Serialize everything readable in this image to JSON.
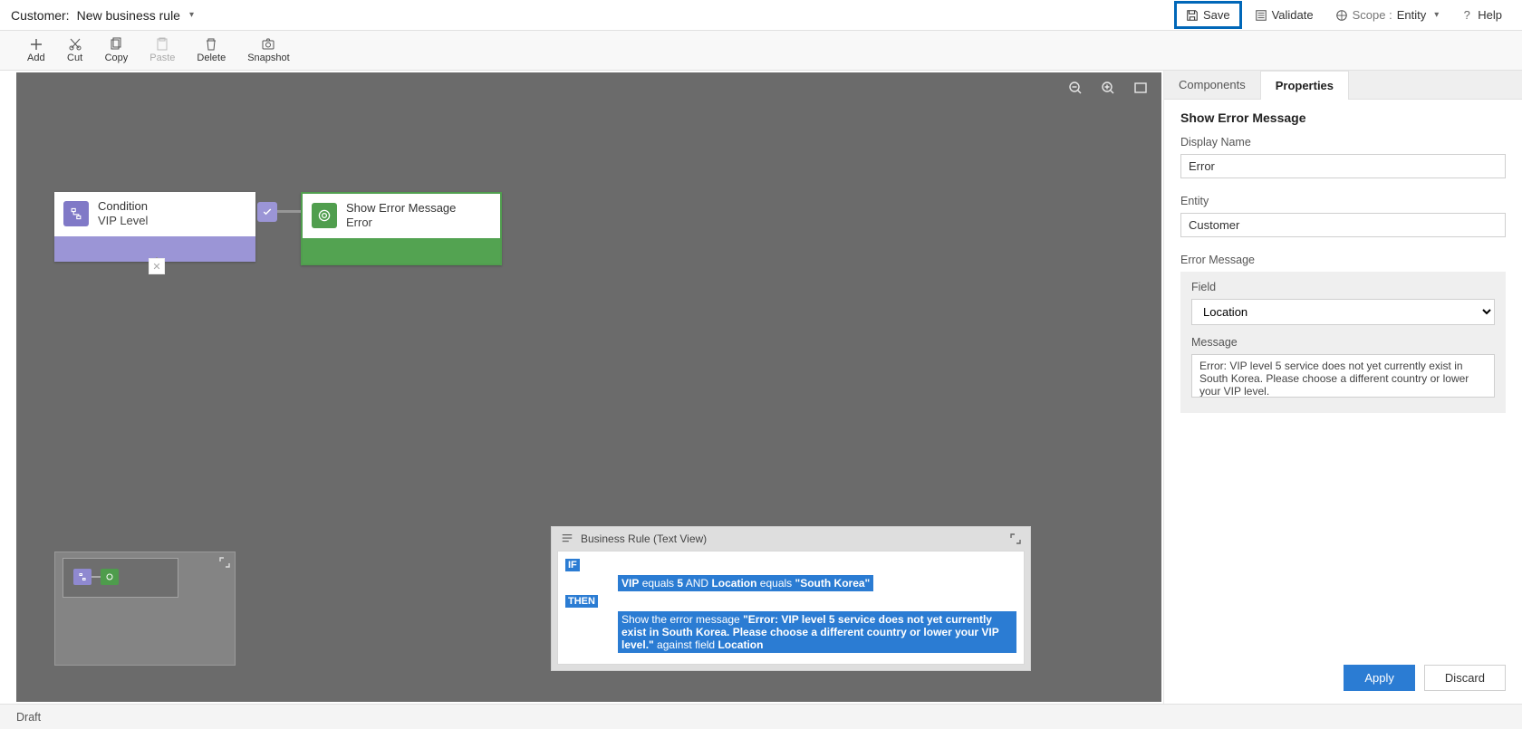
{
  "header": {
    "entity_label_prefix": "Customer:",
    "rule_name": "New business rule",
    "save_label": "Save",
    "validate_label": "Validate",
    "scope_prefix": "Scope :",
    "scope_value": "Entity",
    "help_label": "Help"
  },
  "toolbar": {
    "add": "Add",
    "cut": "Cut",
    "copy": "Copy",
    "paste": "Paste",
    "delete": "Delete",
    "snapshot": "Snapshot"
  },
  "canvas": {
    "condition": {
      "title": "Condition",
      "subtitle": "VIP Level"
    },
    "action": {
      "title": "Show Error Message",
      "subtitle": "Error"
    }
  },
  "textview": {
    "title": "Business Rule (Text View)",
    "kw_if": "IF",
    "kw_then": "THEN",
    "cond_field1": "VIP",
    "cond_op1": "equals",
    "cond_val1": "5",
    "cond_join": "AND",
    "cond_field2": "Location",
    "cond_op2": "equals",
    "cond_val2": "\"South Korea\"",
    "then_prefix": "Show the error message ",
    "then_msg": "\"Error: VIP level 5 service does not yet currently exist in South Korea. Please choose a different country or lower your VIP level.\"",
    "then_suffix1": " against field ",
    "then_field": "Location"
  },
  "right_panel": {
    "tab_components": "Components",
    "tab_properties": "Properties",
    "title": "Show Error Message",
    "display_name_label": "Display Name",
    "display_name_value": "Error",
    "entity_label": "Entity",
    "entity_value": "Customer",
    "errmsg_group_label": "Error Message",
    "field_label": "Field",
    "field_value": "Location",
    "message_label": "Message",
    "message_value": "Error: VIP level 5 service does not yet currently exist in South Korea. Please choose a different country or lower your VIP level.",
    "apply_label": "Apply",
    "discard_label": "Discard"
  },
  "status": {
    "draft": "Draft"
  }
}
